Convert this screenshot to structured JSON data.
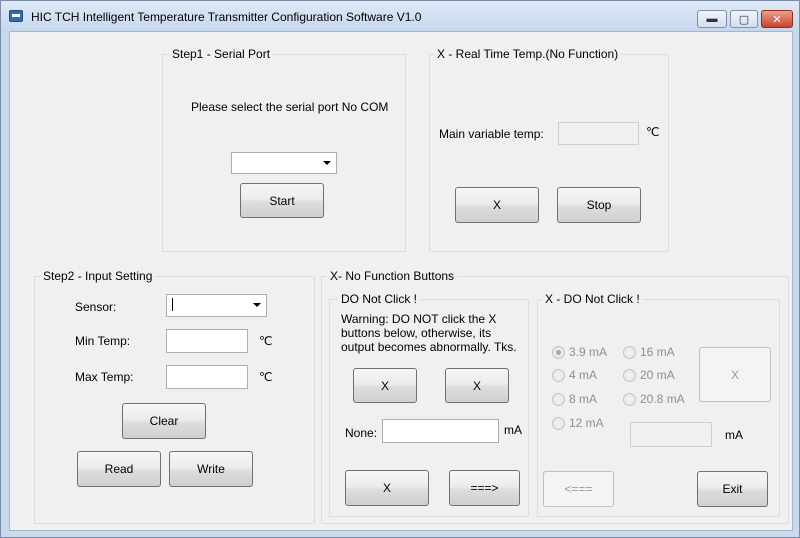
{
  "window": {
    "title": "HIC TCH Intelligent Temperature Transmitter Configuration Software V1.0",
    "min_glyph": "▬",
    "max_glyph": "▢",
    "close_glyph": "✕"
  },
  "step1": {
    "title": "Step1 - Serial Port",
    "message": "Please select the serial port No COM",
    "port_value": "",
    "start_label": "Start"
  },
  "realtime": {
    "title": "X - Real Time Temp.(No Function)",
    "main_label": "Main variable temp:",
    "main_value": "",
    "unit": "℃",
    "x_label": "X",
    "stop_label": "Stop"
  },
  "step2": {
    "title": "Step2 - Input Setting",
    "sensor_label": "Sensor:",
    "sensor_value": "",
    "min_label": "Min Temp:",
    "min_value": "",
    "max_label": "Max Temp:",
    "max_value": "",
    "unit": "℃",
    "clear_label": "Clear",
    "read_label": "Read",
    "write_label": "Write"
  },
  "nofunc": {
    "title": "X- No Function Buttons",
    "donot": {
      "title": "DO Not Click !",
      "warning_line1": "Warning: DO NOT click the X",
      "warning_line2": "buttons below, otherwise, its",
      "warning_line3": "output becomes abnormally. Tks.",
      "x1_label": "X",
      "x2_label": "X",
      "none_label": "None:",
      "none_value": "",
      "unit": "mA",
      "x3_label": "X",
      "arrow_label": "===>"
    },
    "xdonot": {
      "title": "X - DO Not Click !",
      "radios": [
        "3.9 mA",
        "16 mA",
        "4 mA",
        "20 mA",
        "8 mA",
        "20.8 mA",
        "12 mA"
      ],
      "selected": "3.9 mA",
      "x_label": "X",
      "ma_value": "",
      "unit": "mA",
      "back_label": "<===",
      "exit_label": "Exit"
    }
  }
}
